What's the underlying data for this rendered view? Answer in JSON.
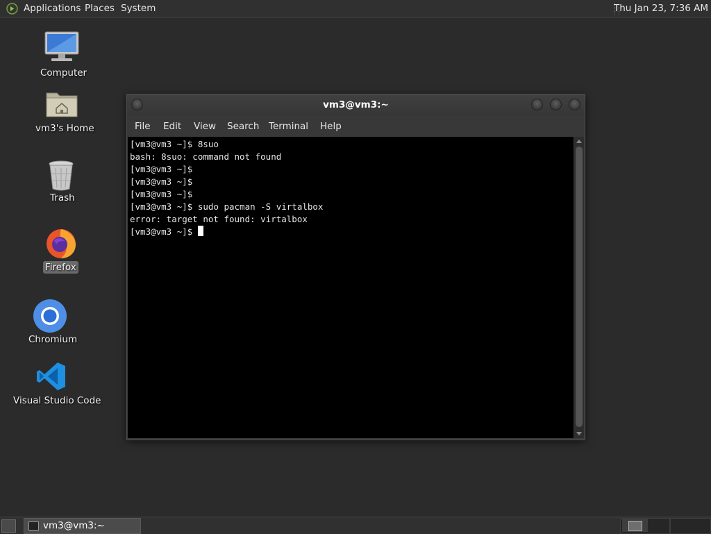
{
  "top_panel": {
    "menus": [
      "Applications",
      "Places",
      "System"
    ],
    "clock": "Thu Jan 23,  7:36 AM"
  },
  "desktop": {
    "icons": [
      {
        "label": "Computer",
        "icon": "computer-icon"
      },
      {
        "label": "vm3's Home",
        "icon": "home-folder-icon"
      },
      {
        "label": "Trash",
        "icon": "trash-icon"
      },
      {
        "label": "Firefox",
        "icon": "firefox-icon"
      },
      {
        "label": "Chromium",
        "icon": "chromium-icon"
      },
      {
        "label": "Visual Studio Code",
        "icon": "vscode-icon"
      }
    ]
  },
  "terminal": {
    "title": "vm3@vm3:~",
    "menu": [
      "File",
      "Edit",
      "View",
      "Search",
      "Terminal",
      "Help"
    ],
    "lines": [
      "[vm3@vm3 ~]$ 8suo",
      "bash: 8suo: command not found",
      "[vm3@vm3 ~]$",
      "[vm3@vm3 ~]$",
      "[vm3@vm3 ~]$",
      "[vm3@vm3 ~]$ sudo pacman -S virtalbox",
      "error: target not found: virtalbox",
      "[vm3@vm3 ~]$ "
    ]
  },
  "taskbar": {
    "items": [
      {
        "label": "vm3@vm3:~",
        "icon": "terminal-icon"
      }
    ]
  },
  "colors": {
    "desktop_bg": "#2b2b2b",
    "panel_bg": "#303030",
    "terminal_bg": "#000000",
    "terminal_fg": "#e6e6e6"
  }
}
